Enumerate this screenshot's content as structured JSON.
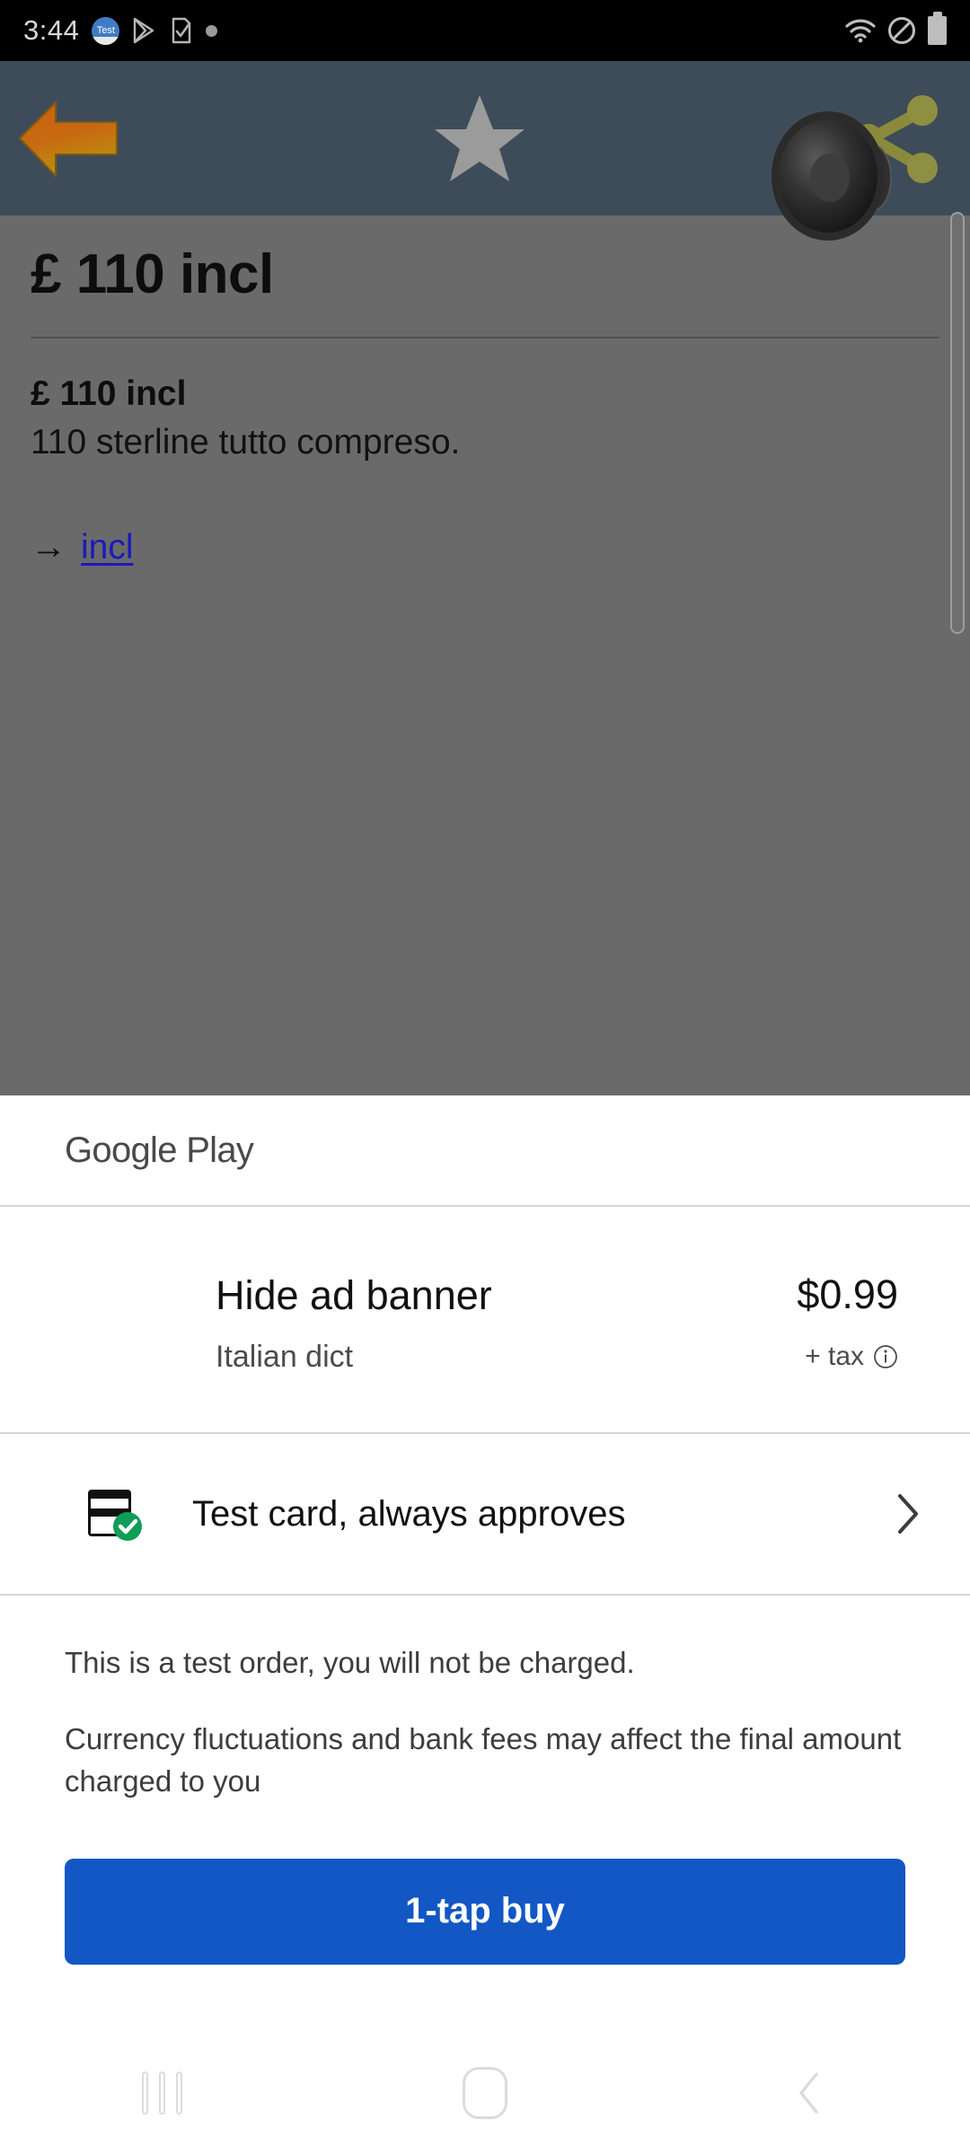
{
  "statusbar": {
    "time": "3:44",
    "icons_left": [
      "test-app-icon",
      "play-store-icon",
      "note-check-icon",
      "dot-icon"
    ],
    "test_badge_label": "Test",
    "icons_right": [
      "wifi-icon",
      "do-not-disturb-icon",
      "battery-icon"
    ]
  },
  "appbar": {
    "back_icon": "back-arrow-icon",
    "favorite_icon": "star-icon",
    "share_icon": "share-icon",
    "background_color": "#3e4c59"
  },
  "dictionary": {
    "headword": "£ 110 incl",
    "sense_term": "£ 110 incl",
    "sense_definition": "110 sterline tutto compreso.",
    "xref_arrow": "→",
    "xref_link": "incl",
    "speaker_icon": "speaker-icon",
    "link_color": "#1a1ac0",
    "scrim_color": "#6a6a6a"
  },
  "sheet": {
    "brand": "Google Play",
    "item": {
      "title": "Hide ad banner",
      "subtitle": "Italian dict",
      "price": "$0.99",
      "tax_note": "+ tax",
      "tax_info_icon": "info-icon"
    },
    "payment": {
      "icon": "credit-card-icon",
      "verified_badge": "check-badge",
      "label": "Test card, always approves",
      "chevron": "chevron-right-icon"
    },
    "notes": [
      "This is a test order, you will not be charged.",
      "Currency fluctuations and bank fees may affect the final amount charged to you"
    ],
    "buy_button_label": "1-tap buy",
    "buy_button_color": "#1257c4"
  },
  "navbar": {
    "recents_icon": "recents-icon",
    "home_icon": "home-icon",
    "back_icon": "nav-back-icon"
  }
}
